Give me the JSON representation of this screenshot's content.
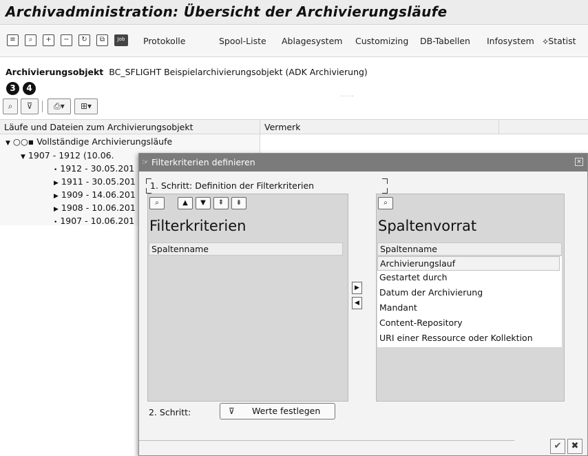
{
  "window": {
    "title": "Archivadministration: Übersicht der Archivierungsläufe"
  },
  "toolbar": {
    "icons": [
      "list-icon",
      "find-icon",
      "expand-icon",
      "collapse-icon",
      "refresh-icon",
      "copy-icon",
      "job-icon"
    ],
    "job_label": "Job",
    "menu": [
      "Protokolle",
      "Spool-Liste",
      "Ablagesystem",
      "Customizing",
      "DB-Tabellen",
      "Infosystem",
      "Statist"
    ]
  },
  "object": {
    "label": "Archivierungsobjekt",
    "value": "BC_SFLIGHT Beispielarchivierungsobjekt (ADK Archivierung)"
  },
  "badges": [
    "3",
    "4"
  ],
  "grid": {
    "col1": "Läufe und Dateien zum Archivierungsobjekt",
    "col2": "Vermerk",
    "root": "Vollständige Archivierungsläufe",
    "group": "1907 - 1912 (10.06.",
    "rows": [
      "1912 - 30.05.201",
      "1911 - 30.05.201",
      "1909 - 14.06.201",
      "1908 - 10.06.201",
      "1907 - 10.06.201"
    ]
  },
  "dialog": {
    "title": "Filterkriterien definieren",
    "step1": "1. Schritt: Definition der Filterkriterien",
    "left_heading": "Filterkriterien",
    "right_heading": "Spaltenvorrat",
    "col_header": "Spaltenname",
    "available_columns": [
      "Archivierungslauf",
      "Gestartet durch",
      "Datum der Archivierung",
      "Mandant",
      "Content-Repository",
      "URI einer Ressource oder Kollektion"
    ],
    "step2": "2. Schritt:",
    "values_button": "Werte festlegen"
  }
}
